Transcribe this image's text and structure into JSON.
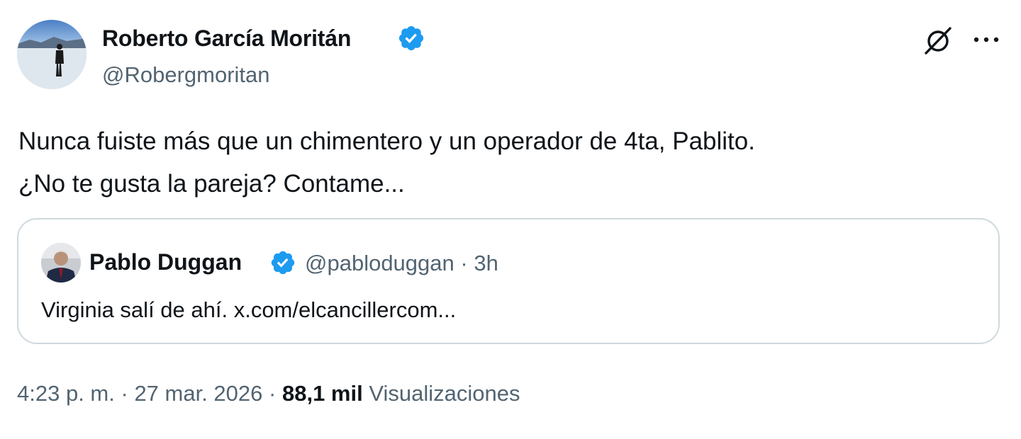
{
  "author": {
    "name": "Roberto García Moritán",
    "handle": "@Robergmoritan",
    "verified": true
  },
  "tweet": {
    "lines": [
      "Nunca fuiste más que un chimentero y un operador de 4ta, Pablito.",
      "¿No te gusta la pareja? Contame..."
    ]
  },
  "quoted": {
    "name": "Pablo Duggan",
    "handle": "@pabloduggan",
    "separator": "·",
    "time": "3h",
    "text": "Virginia salí de ahí. x.com/elcancillercom..."
  },
  "footer": {
    "time": "4:23 p. m.",
    "separator1": "·",
    "date": "27 mar. 2026",
    "separator2": "·",
    "views_count": "88,1 mil",
    "views_label": "Visualizaciones"
  },
  "icons": {
    "verified": "verified-badge-icon",
    "grok": "grok-icon",
    "more": "more-options-icon"
  },
  "colors": {
    "verified_blue": "#1d9bf0",
    "secondary_text": "#536471",
    "primary_text": "#0f1419",
    "border": "#cfd9de"
  }
}
